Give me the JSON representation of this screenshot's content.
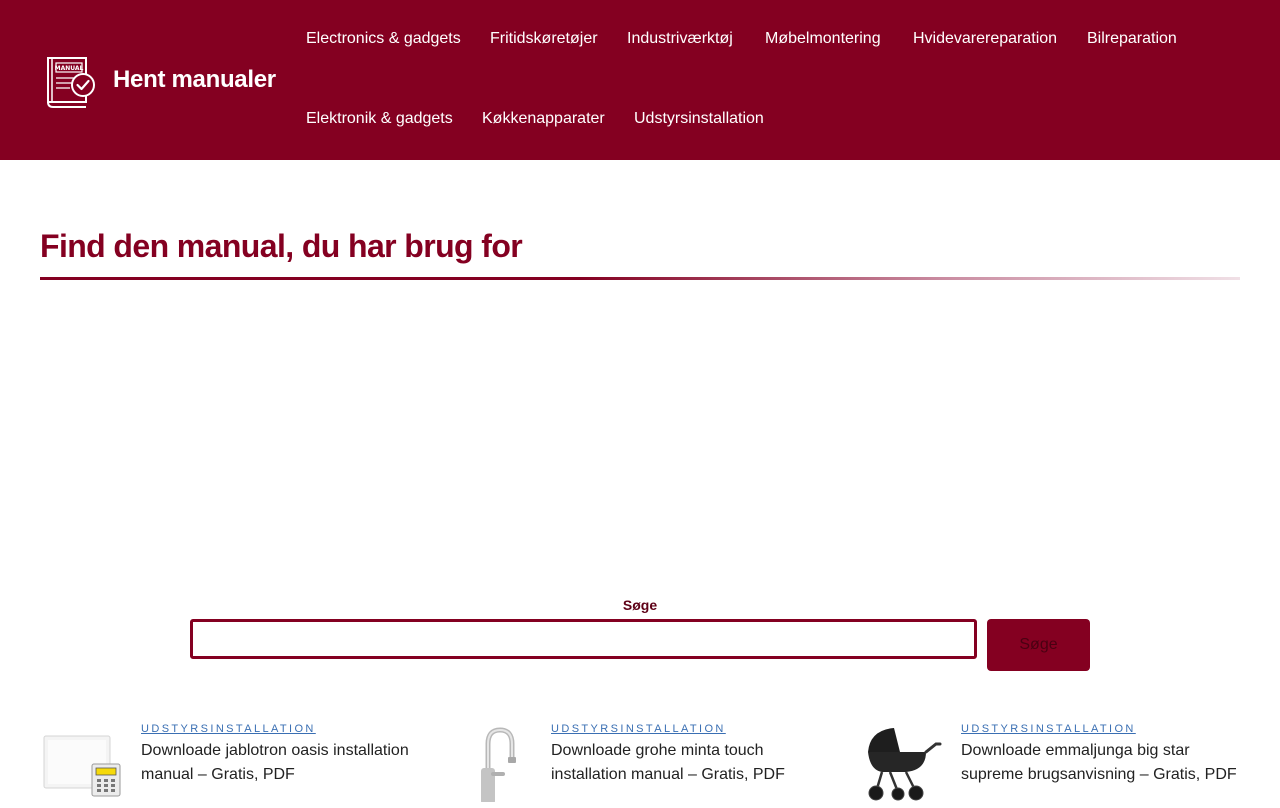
{
  "site": {
    "title": "Hent manualer",
    "logo_text": "MANUAL"
  },
  "nav": {
    "items": [
      {
        "label": "Electronics & gadgets"
      },
      {
        "label": "Fritidskøretøjer"
      },
      {
        "label": "Industriværktøj"
      },
      {
        "label": "Møbelmontering"
      },
      {
        "label": "Hvidevarereparation"
      },
      {
        "label": "Bilreparation"
      },
      {
        "label": "Elektronik & gadgets"
      },
      {
        "label": "Køkkenapparater"
      },
      {
        "label": "Udstyrsinstallation"
      }
    ]
  },
  "main": {
    "title": "Find den manual, du har brug for"
  },
  "search": {
    "label": "Søge",
    "value": "",
    "placeholder": "",
    "button_label": "Søge"
  },
  "posts": [
    {
      "category": "UDSTYRSINSTALLATION",
      "title": "Downloade jablotron oasis installation manual – Gratis, PDF",
      "thumb_icon": "alarm-keypad-image"
    },
    {
      "category": "UDSTYRSINSTALLATION",
      "title": "Downloade grohe minta touch installation manual – Gratis, PDF",
      "thumb_icon": "kitchen-faucet-image"
    },
    {
      "category": "UDSTYRSINSTALLATION",
      "title": "Downloade emmaljunga big star supreme brugsanvisning – Gratis, PDF",
      "thumb_icon": "pram-image"
    }
  ],
  "colors": {
    "brand": "#840021",
    "link": "#3a6fb3",
    "background": "#ffffff"
  }
}
